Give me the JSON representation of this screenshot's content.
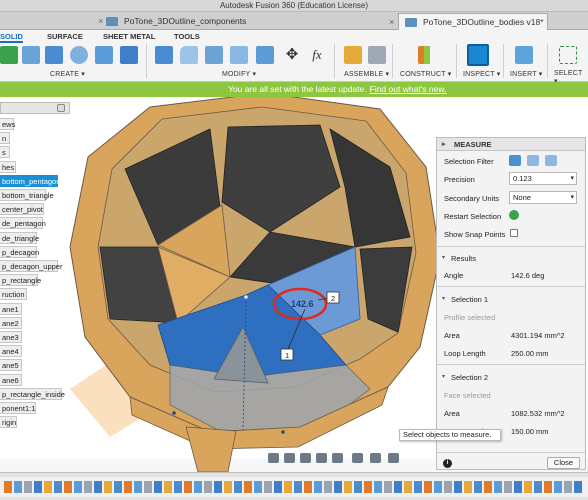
{
  "app": {
    "title": "Autodesk Fusion 360 (Education License)"
  },
  "tabs": [
    {
      "label": "PoTone_3DOutline_components v5*",
      "active": false
    },
    {
      "label": "PoTone_3DOutline_bodies v18*",
      "active": true
    }
  ],
  "ribbon": {
    "tabs": [
      "SOLID",
      "SURFACE",
      "SHEET METAL",
      "TOOLS"
    ],
    "groups": [
      "CREATE ▾",
      "MODIFY ▾",
      "ASSEMBLE ▾",
      "CONSTRUCT ▾",
      "INSPECT ▾",
      "INSERT ▾",
      "SELECT ▾"
    ],
    "fx_label": "fx"
  },
  "banner": {
    "text": "You are all set with the latest update.",
    "link": "Find out what's new."
  },
  "browser": {
    "items": [
      {
        "label": "ews",
        "selected": false
      },
      {
        "label": "n",
        "selected": false
      },
      {
        "label": "s",
        "selected": false
      },
      {
        "label": "hes",
        "selected": false
      },
      {
        "label": "bottom_pentagon",
        "selected": true
      },
      {
        "label": "bottom_triangle",
        "selected": false
      },
      {
        "label": "center_pivot",
        "selected": false
      },
      {
        "label": "de_pentagon",
        "selected": false
      },
      {
        "label": "de_triangle",
        "selected": false
      },
      {
        "label": "p_decagon",
        "selected": false
      },
      {
        "label": "p_decagon_upper",
        "selected": false
      },
      {
        "label": "p_rectangle",
        "selected": false
      },
      {
        "label": "ruction",
        "selected": false
      },
      {
        "label": "ane1",
        "selected": false
      },
      {
        "label": "ane2",
        "selected": false
      },
      {
        "label": "ane3",
        "selected": false
      },
      {
        "label": "ane4",
        "selected": false
      },
      {
        "label": "ane5",
        "selected": false
      },
      {
        "label": "ane6",
        "selected": false
      },
      {
        "label": "p_rectangle_inside",
        "selected": false
      },
      {
        "label": "ponent1:1",
        "selected": false
      },
      {
        "label": "rigin",
        "selected": false
      }
    ]
  },
  "viewport": {
    "angle_label": "142.6",
    "marker_1": "1",
    "marker_2": "2",
    "tooltip": "Select objects to measure."
  },
  "measure": {
    "title": "MEASURE",
    "selection_filter_label": "Selection Filter",
    "precision_label": "Precision",
    "precision_value": "0.123",
    "secondary_units_label": "Secondary Units",
    "secondary_units_value": "None",
    "restart_selection_label": "Restart Selection",
    "show_snap_points_label": "Show Snap Points",
    "results_label": "Results",
    "angle_label": "Angle",
    "angle_value": "142.6 deg",
    "selection1_label": "Selection 1",
    "selection1_type": "Profile selected",
    "area_label": "Area",
    "selection1_area": "4301.194 mm^2",
    "loop_length_label": "Loop Length",
    "selection1_loop": "250.00 mm",
    "selection2_label": "Selection 2",
    "selection2_type": "Face selected",
    "selection2_area": "1082.532 mm^2",
    "selection2_loop": "150.00 mm",
    "close_label": "Close",
    "info_label": "i"
  },
  "colors": {
    "accent": "#1a6fc1",
    "banner": "#8dc63f",
    "selected_face": "#2f6fbf",
    "wood": "#d9a45c",
    "dark_face": "#3b3b3b"
  }
}
